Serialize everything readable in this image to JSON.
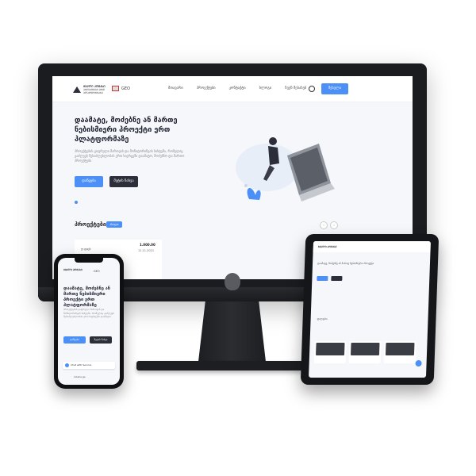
{
  "desktop": {
    "logo_text": "ᲒᲕᲐᲚᲘ ᲙᲝᲛᲞᲡᲘ",
    "logo_sub": "ᲞᲠᲝᲔᲥᲢᲔᲑᲘ ᲔᲠᲗ ᲞᲚᲐᲢᲤᲝᲠᲛᲐᲖᲔ",
    "lang": "GEO",
    "menu": [
      "მთავარი",
      "პროექტები",
      "კონტაქტი",
      "ბლოგი",
      "ჩვენ შესახებ"
    ],
    "login_label": "შესვლა",
    "hero_title": "დაამატე, მოძებნე ან მართე ნებისმიერი პროექტი ერთ პლატფორმაზე",
    "hero_desc": "პროექტების ციფრული მართვის და მონიტორინგის სისტემა, რომელიც გაძლევს შესაძლებლობას ერთ სივრცეში დაამატო, მოძებნო და მართო პროექტები",
    "btn_primary": "დაწყება",
    "btn_secondary": "მეტის ნახვა",
    "projects_label": "პროექტები",
    "projects_badge": "ახალი",
    "card_name": "დ.ფიცხ",
    "card_price": "1.000.00",
    "card_date": "11.11.2021"
  },
  "phone": {
    "logo_text": "ᲒᲕᲐᲚᲘ ᲙᲝᲛᲞᲡᲘ",
    "lang": "GEO",
    "hero_title": "დაამატე, მოძებნე ან მართე ნებისმიერი პროექტი ერთ პლატფორმაზე",
    "hero_desc": "პროექტების ციფრული მართვის და მონიტორინგის სისტემა, რომელიც გაძლევს შესაძლებლობას ერთ სივრცეში დაამატო",
    "btn_primary": "დაწყება",
    "btn_secondary": "მეტის ნახვა",
    "chat_label": "Chat with Service",
    "url": "lobelia.ge"
  },
  "tablet": {
    "logo_text": "ᲒᲕᲐᲚᲘ ᲙᲝᲛᲞᲡᲘ",
    "row_text": "დაამატე, მოძებნე ან მართე ნებისმიერი პროექტი",
    "filter_text": "ფილტრი"
  },
  "colors": {
    "accent": "#4b8ff7",
    "dark": "#2c2f3a",
    "device": "#1b1c1f"
  }
}
